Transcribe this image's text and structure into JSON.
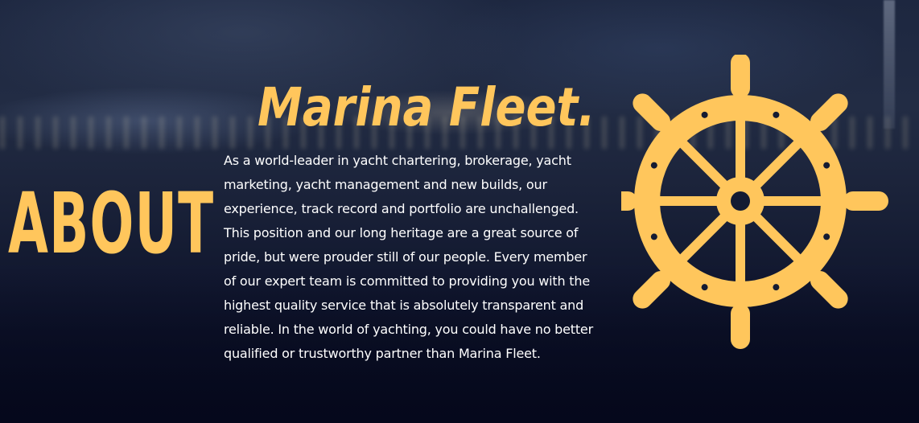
{
  "section": {
    "heading": "ABOUT",
    "title": "Marina Fleet.",
    "description": "As a world-leader in yacht chartering, brokerage, yacht marketing, yacht management and new builds, our experience, track record and portfolio are unchallenged. This position and our long heritage are a great source of pride, but were prouder still of our people. Every member of our expert team is committed to providing you with the highest quality service that is absolutely transparent and reliable. In the world of yachting, you could have no better qualified or trustworthy partner than Marina Fleet."
  },
  "icons": {
    "decoration": "ship-wheel-icon"
  },
  "colors": {
    "accent": "#ffc65c",
    "text": "#ffffff",
    "background": "#141b32"
  }
}
